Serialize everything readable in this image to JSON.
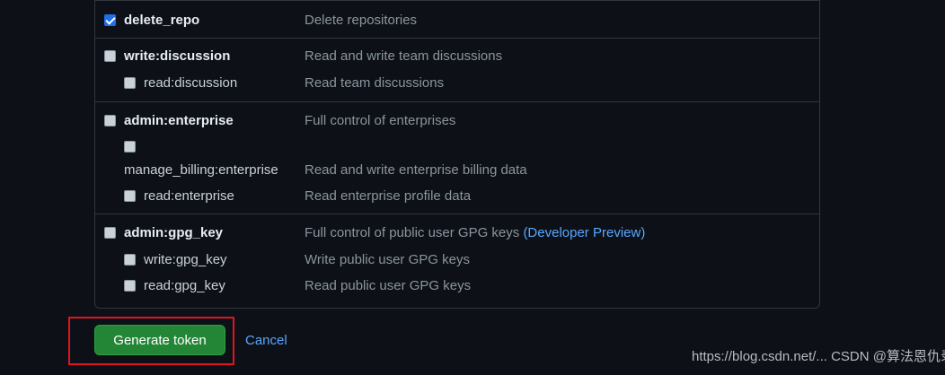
{
  "scopes": {
    "delete_repo": {
      "name": "delete_repo",
      "desc": "Delete repositories",
      "checked": true
    },
    "write_discussion": {
      "name": "write:discussion",
      "desc": "Read and write team discussions"
    },
    "read_discussion": {
      "name": "read:discussion",
      "desc": "Read team discussions"
    },
    "admin_enterprise": {
      "name": "admin:enterprise",
      "desc": "Full control of enterprises"
    },
    "manage_billing_enterprise": {
      "name": "manage_billing:enterprise",
      "desc": "Read and write enterprise billing data"
    },
    "read_enterprise": {
      "name": "read:enterprise",
      "desc": "Read enterprise profile data"
    },
    "admin_gpg_key": {
      "name": "admin:gpg_key",
      "desc": "Full control of public user GPG keys",
      "desc_link": "(Developer Preview)"
    },
    "write_gpg_key": {
      "name": "write:gpg_key",
      "desc": "Write public user GPG keys"
    },
    "read_gpg_key": {
      "name": "read:gpg_key",
      "desc": "Read public user GPG keys"
    }
  },
  "actions": {
    "generate_label": "Generate token",
    "cancel_label": "Cancel"
  },
  "watermark": "https://blog.csdn.net/... CSDN @算法恩仇录",
  "colors": {
    "background": "#0d1117",
    "primary_button": "#238636",
    "link": "#58a6ff",
    "highlight": "#e0141e"
  }
}
